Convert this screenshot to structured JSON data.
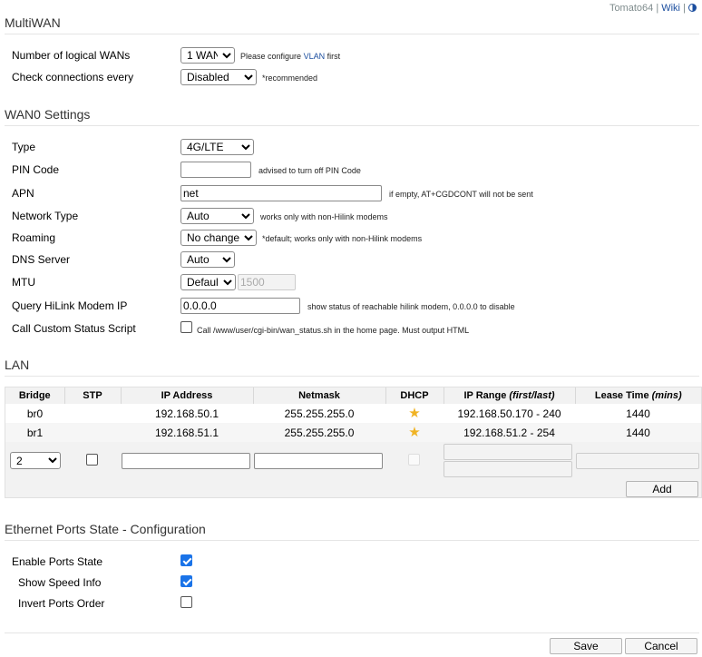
{
  "topbar": {
    "brand": "Tomato64",
    "sep1": "|",
    "wiki": "Wiki",
    "sep2": "|"
  },
  "multiwan": {
    "title": "MultiWAN",
    "num_wans_label": "Number of logical WANs",
    "num_wans_value": "1 WAN",
    "num_wans_note_pre": "Please configure",
    "num_wans_note_link": "VLAN",
    "num_wans_note_post": "first",
    "check_label": "Check connections every",
    "check_value": "Disabled",
    "check_note": "*recommended"
  },
  "wan0": {
    "title": "WAN0 Settings",
    "type_label": "Type",
    "type_value": "4G/LTE",
    "pin_label": "PIN Code",
    "pin_value": "",
    "pin_note": "advised to turn off PIN Code",
    "apn_label": "APN",
    "apn_value": "net",
    "apn_note": "if empty, AT+CGDCONT will not be sent",
    "nettype_label": "Network Type",
    "nettype_value": "Auto",
    "nettype_note": "works only with non-Hilink modems",
    "roaming_label": "Roaming",
    "roaming_value": "No change*",
    "roaming_note": "*default; works only with non-Hilink modems",
    "dns_label": "DNS Server",
    "dns_value": "Auto",
    "mtu_label": "MTU",
    "mtu_value": "Default",
    "mtu_input": "1500",
    "hilink_label": "Query HiLink Modem IP",
    "hilink_value": "0.0.0.0",
    "hilink_note": "show status of reachable hilink modem, 0.0.0.0 to disable",
    "script_label": "Call Custom Status Script",
    "script_checked": false,
    "script_note": "Call /www/user/cgi-bin/wan_status.sh in the home page. Must output HTML"
  },
  "lan": {
    "title": "LAN",
    "headers": {
      "bridge": "Bridge",
      "stp": "STP",
      "ip": "IP Address",
      "netmask": "Netmask",
      "dhcp": "DHCP",
      "range_pre": "IP Range ",
      "range_em": "(first/last)",
      "lease_pre": "Lease Time ",
      "lease_em": "(mins)"
    },
    "rows": [
      {
        "bridge": "br0",
        "stp": "",
        "ip": "192.168.50.1",
        "netmask": "255.255.255.0",
        "range": "192.168.50.170 - 240",
        "lease": "1440"
      },
      {
        "bridge": "br1",
        "stp": "",
        "ip": "192.168.51.1",
        "netmask": "255.255.255.0",
        "range": "192.168.51.2 - 254",
        "lease": "1440"
      }
    ],
    "new_bridge_value": "2",
    "add_label": "Add"
  },
  "ports": {
    "title": "Ethernet Ports State - Configuration",
    "enable_label": "Enable Ports State",
    "enable_checked": true,
    "speed_label": "Show Speed Info",
    "speed_checked": true,
    "invert_label": "Invert Ports Order",
    "invert_checked": false
  },
  "footer": {
    "save_label": "Save",
    "cancel_label": "Cancel"
  },
  "colors": {
    "link": "#1a4d9e",
    "checkbox_accent": "#1a73e8",
    "star": "#f0b323"
  }
}
